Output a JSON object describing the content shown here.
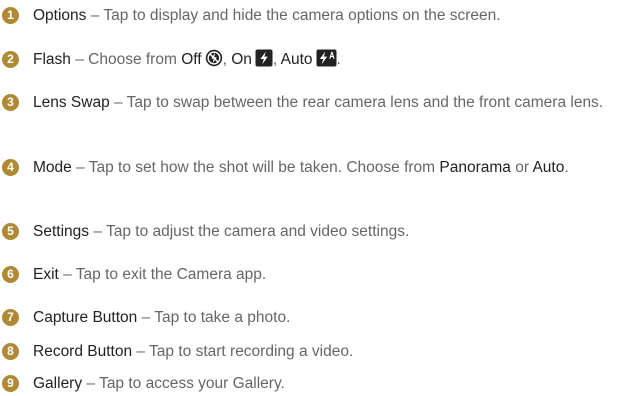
{
  "accent_color": "#b08a32",
  "items": [
    {
      "num": "1",
      "term": "Options",
      "dash": " – ",
      "desc": "Tap to display and hide the camera options on the screen."
    },
    {
      "num": "2",
      "term": "Flash",
      "dash": " – ",
      "desc_a": "Choose from ",
      "off": "Off",
      "sep1": ", ",
      "on": "On",
      "sep2": ", ",
      "auto": "Auto",
      "end": ".",
      "icons": [
        "flash-off-icon",
        "flash-on-icon",
        "flash-auto-icon"
      ]
    },
    {
      "num": "3",
      "term": "Lens Swap",
      "dash": " – ",
      "desc": "Tap to swap between the rear camera lens and the front camera lens."
    },
    {
      "num": "4",
      "term": "Mode",
      "dash": " – ",
      "desc_a": "Tap to set how the shot will be taken. Choose from ",
      "opt1": "Panorama",
      "mid": " or ",
      "opt2": "Auto",
      "end": "."
    },
    {
      "num": "5",
      "term": "Settings",
      "dash": " – ",
      "desc": "Tap to adjust the camera and video settings."
    },
    {
      "num": "6",
      "term": "Exit",
      "dash": " – ",
      "desc": "Tap to exit the Camera app."
    },
    {
      "num": "7",
      "term": "Capture Button",
      "dash": " – ",
      "desc": "Tap to take a photo."
    },
    {
      "num": "8",
      "term": "Record Button",
      "dash": " – ",
      "desc": "Tap to start recording a video."
    },
    {
      "num": "9",
      "term": "Gallery",
      "dash": " – ",
      "desc": "Tap to access your Gallery."
    }
  ]
}
